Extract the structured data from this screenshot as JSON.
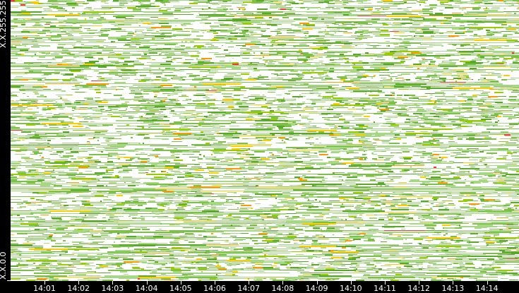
{
  "chart_data": {
    "type": "heatmap",
    "title": "",
    "xlabel": "",
    "ylabel": "",
    "x_ticks": [
      "14:01",
      "14:02",
      "14:03",
      "14:04",
      "14:05",
      "14:06",
      "14:07",
      "14:08",
      "14:09",
      "14:10",
      "14:11",
      "14:12",
      "14:13",
      "14:14"
    ],
    "y_labels": {
      "top": "X.X.255.255",
      "bottom": "X.X.0.0"
    },
    "color_scale": [
      "#a6d785",
      "#7cc04a",
      "#5aa82a",
      "#99cc00",
      "#ffcc00",
      "#ff9900",
      "#ff3333"
    ]
  }
}
